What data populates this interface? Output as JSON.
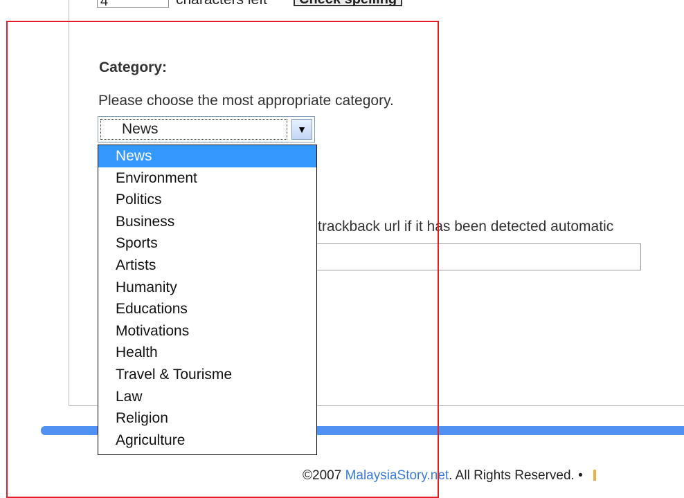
{
  "top_row": {
    "count_value": "4",
    "chars_left_label": "characters left",
    "check_spelling_label": "Check spelling"
  },
  "category": {
    "heading": "Category:",
    "description": "Please choose the most appropriate category.",
    "selected": "News",
    "options": [
      "News",
      "Environment",
      "Politics",
      "Business",
      "Sports",
      "Artists",
      "Humanity",
      "Educations",
      "Motivations",
      "Health",
      "Travel & Tourisme",
      "Law",
      "Religion",
      "Agriculture"
    ]
  },
  "trackback": {
    "text": "trackback url if it has been detected automatic",
    "value": ""
  },
  "footer": {
    "copyright": "©2007",
    "site": "MalaysiaStory.net",
    "rights": ". All Rights Reserved.",
    "separator": "•"
  },
  "colors": {
    "highlight": "#3399ff",
    "accent_bar": "#4f92f2",
    "annotation": "#e31d2b",
    "link": "#3a7bd5"
  },
  "icons": {
    "select_arrow": "chevron-down-icon"
  }
}
